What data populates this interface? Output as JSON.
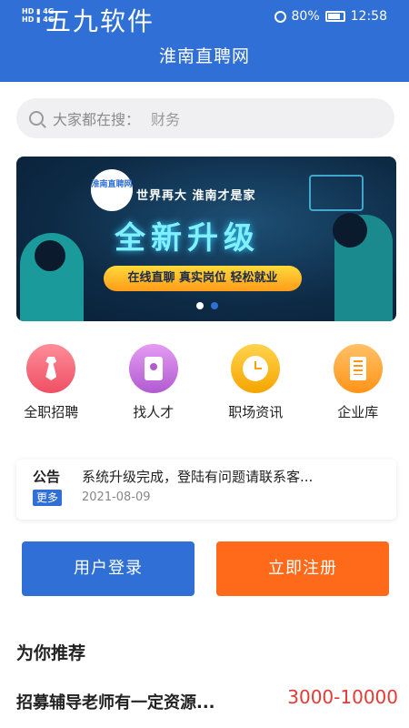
{
  "status_bar": {
    "left_top": "HD ▮ 4G",
    "left_bottom": "HD ▮ 4G",
    "watermark": "五九软件",
    "battery": "80%",
    "time": "12:58"
  },
  "nav": {
    "title": "淮南直聘网"
  },
  "search": {
    "prefix": "大家都在搜：",
    "value": "财务"
  },
  "banner": {
    "logo_text": "淮南直聘网",
    "slogan": "世界再大 淮南才是家",
    "headline": "全新升级",
    "subline": "在线直聊 真实岗位 轻松就业",
    "slides_total": 2,
    "active_slide": 1
  },
  "quick_entries": [
    {
      "label": "全职招聘",
      "icon": "tie-icon"
    },
    {
      "label": "找人才",
      "icon": "resume-icon"
    },
    {
      "label": "职场资讯",
      "icon": "clock-icon"
    },
    {
      "label": "企业库",
      "icon": "building-icon"
    }
  ],
  "notice": {
    "tag": "公告",
    "more": "更多",
    "text": "系统升级完成，登陆有问题请联系客...",
    "date": "2021-08-09"
  },
  "buttons": {
    "login": "用户登录",
    "register": "立即注册"
  },
  "recommend": {
    "title": "为你推荐",
    "job_title": "招募辅导老师有一定资源...",
    "salary": "3000-10000"
  },
  "colors": {
    "primary": "#2f6fd6",
    "accent": "#ff6a1a",
    "salary": "#e53935"
  }
}
